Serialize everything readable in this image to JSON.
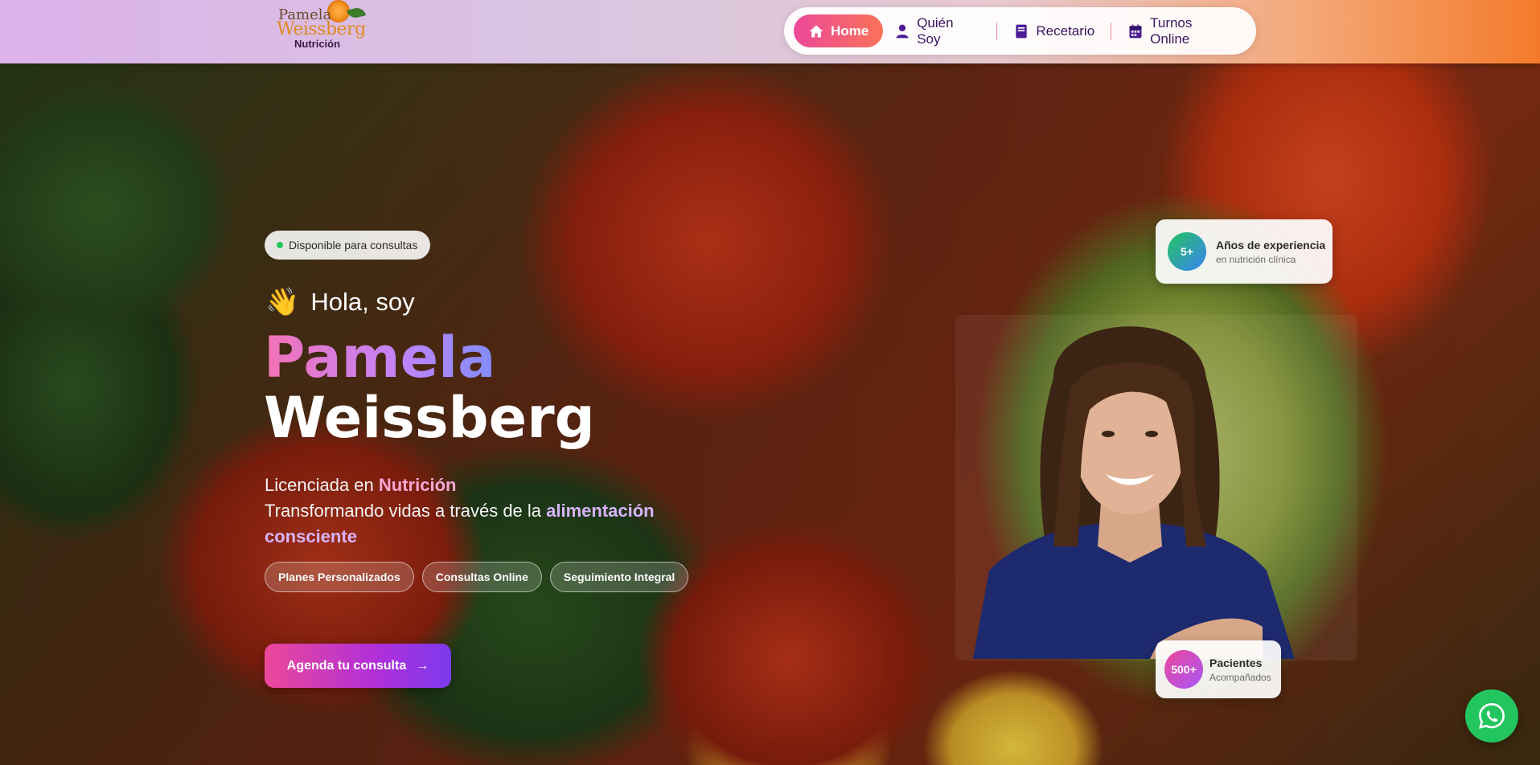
{
  "header": {
    "logo": {
      "line1": "Pamela",
      "line2": "Weissberg",
      "line3": "Nutrición"
    },
    "nav": [
      {
        "label": "Home",
        "icon": "home-icon",
        "active": true
      },
      {
        "label": "Quién Soy",
        "icon": "user-icon",
        "active": false
      },
      {
        "label": "Recetario",
        "icon": "book-icon",
        "active": false
      },
      {
        "label": "Turnos Online",
        "icon": "calendar-icon",
        "active": false
      }
    ]
  },
  "hero": {
    "availability_badge": "Disponible para consultas",
    "greeting_emoji": "👋",
    "greeting": "Hola, soy",
    "first_name": "Pamela",
    "last_name": "Weissberg",
    "tagline": {
      "line1_prefix": "Licenciada en ",
      "line1_highlight": "Nutrición",
      "line2_prefix": "Transformando vidas a través de la ",
      "line2_highlight": "alimentación consciente"
    },
    "pills": [
      "Planes Personalizados",
      "Consultas Online",
      "Seguimiento Integral"
    ],
    "cta": {
      "label": "Agenda tu consulta",
      "arrow": "→"
    }
  },
  "stats": {
    "experience": {
      "value": "5+",
      "title": "Años de experiencia",
      "subtitle": "en nutrición clínica"
    },
    "patients": {
      "value": "500+",
      "title": "Pacientes",
      "subtitle": "Acompañados"
    }
  },
  "colors": {
    "accent_pink": "#ec4899",
    "accent_purple": "#7c3aed",
    "whatsapp_green": "#22c55e",
    "nav_text": "#3a1660"
  }
}
